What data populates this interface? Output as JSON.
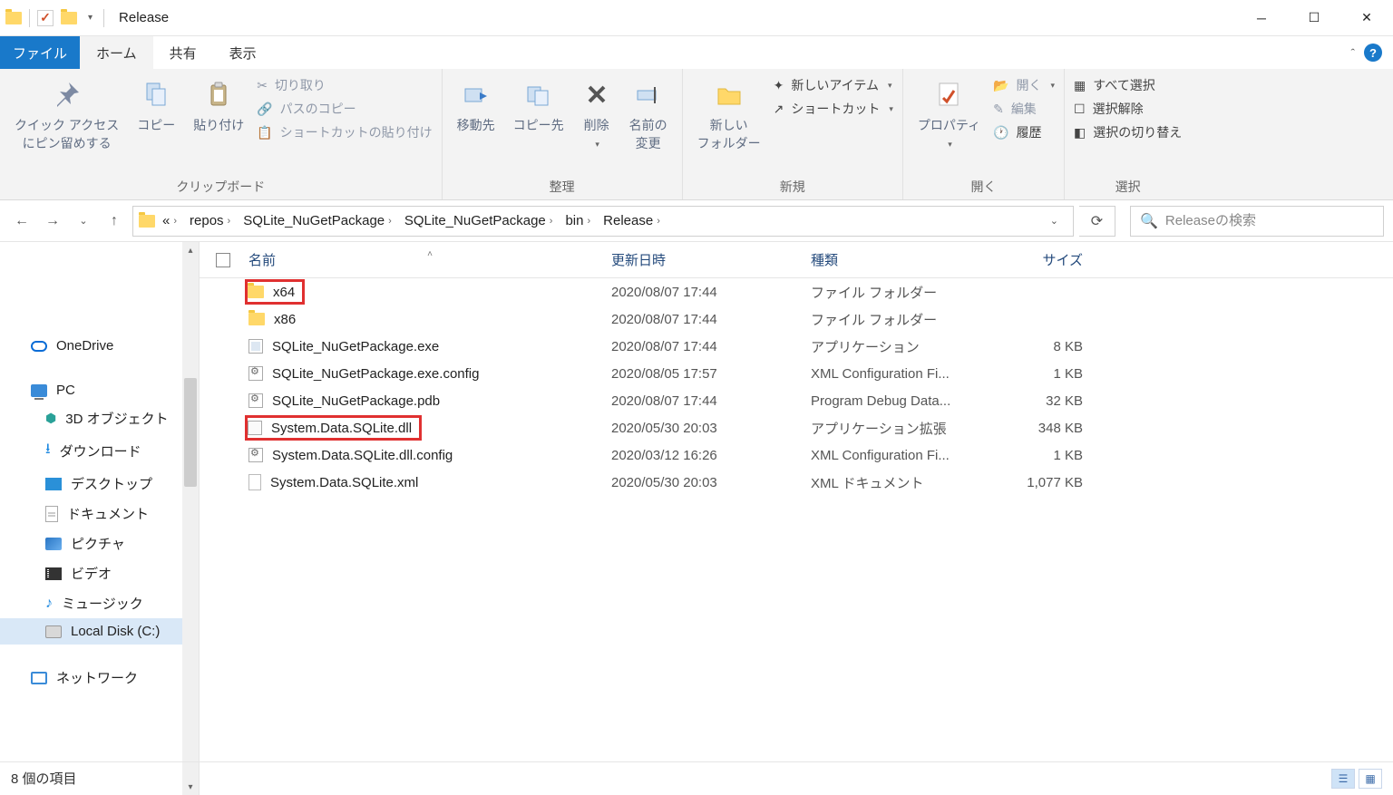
{
  "title": "Release",
  "tabs": {
    "file": "ファイル",
    "home": "ホーム",
    "share": "共有",
    "view": "表示"
  },
  "ribbon": {
    "clipboard": {
      "pin": "クイック アクセス\nにピン留めする",
      "copy": "コピー",
      "paste": "貼り付け",
      "cut": "切り取り",
      "copy_path": "パスのコピー",
      "paste_shortcut": "ショートカットの貼り付け",
      "group": "クリップボード"
    },
    "organize": {
      "move_to": "移動先",
      "copy_to": "コピー先",
      "delete": "削除",
      "rename": "名前の\n変更",
      "group": "整理"
    },
    "new": {
      "new_folder": "新しい\nフォルダー",
      "new_item": "新しいアイテム",
      "shortcut": "ショートカット",
      "group": "新規"
    },
    "open": {
      "properties": "プロパティ",
      "open": "開く",
      "edit": "編集",
      "history": "履歴",
      "group": "開く"
    },
    "select": {
      "select_all": "すべて選択",
      "select_none": "選択解除",
      "invert": "選択の切り替え",
      "group": "選択"
    }
  },
  "breadcrumb": [
    "repos",
    "SQLite_NuGetPackage",
    "SQLite_NuGetPackage",
    "bin",
    "Release"
  ],
  "search_placeholder": "Releaseの検索",
  "columns": {
    "name": "名前",
    "date": "更新日時",
    "type": "種類",
    "size": "サイズ"
  },
  "files": [
    {
      "icon": "folder",
      "name": "x64",
      "date": "2020/08/07 17:44",
      "type": "ファイル フォルダー",
      "size": "",
      "highlight": true
    },
    {
      "icon": "folder",
      "name": "x86",
      "date": "2020/08/07 17:44",
      "type": "ファイル フォルダー",
      "size": ""
    },
    {
      "icon": "app",
      "name": "SQLite_NuGetPackage.exe",
      "date": "2020/08/07 17:44",
      "type": "アプリケーション",
      "size": "8 KB"
    },
    {
      "icon": "cfg",
      "name": "SQLite_NuGetPackage.exe.config",
      "date": "2020/08/05 17:57",
      "type": "XML Configuration Fi...",
      "size": "1 KB"
    },
    {
      "icon": "cfg",
      "name": "SQLite_NuGetPackage.pdb",
      "date": "2020/08/07 17:44",
      "type": "Program Debug Data...",
      "size": "32 KB"
    },
    {
      "icon": "dll",
      "name": "System.Data.SQLite.dll",
      "date": "2020/05/30 20:03",
      "type": "アプリケーション拡張",
      "size": "348 KB",
      "highlight": true
    },
    {
      "icon": "cfg",
      "name": "System.Data.SQLite.dll.config",
      "date": "2020/03/12 16:26",
      "type": "XML Configuration Fi...",
      "size": "1 KB"
    },
    {
      "icon": "xml",
      "name": "System.Data.SQLite.xml",
      "date": "2020/05/30 20:03",
      "type": "XML ドキュメント",
      "size": "1,077 KB"
    }
  ],
  "nav": {
    "onedrive": "OneDrive",
    "pc": "PC",
    "pc_children": [
      "3D オブジェクト",
      "ダウンロード",
      "デスクトップ",
      "ドキュメント",
      "ピクチャ",
      "ビデオ",
      "ミュージック",
      "Local Disk (C:)"
    ],
    "network": "ネットワーク"
  },
  "status": "8 個の項目"
}
